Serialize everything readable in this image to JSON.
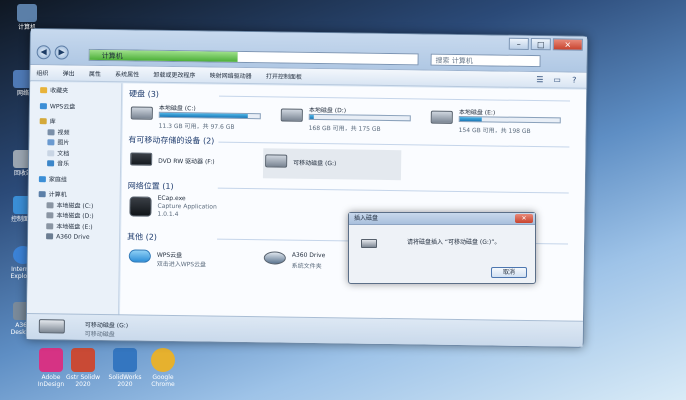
{
  "desktop": {
    "icons": [
      {
        "label": "计算机",
        "icon": "computer-icon",
        "color": "#5b7fa8"
      },
      {
        "label": "网络",
        "icon": "network-icon",
        "color": "#4e79b5"
      },
      {
        "label": "回收站",
        "icon": "recycle-bin-icon",
        "color": "#9aa5b1"
      },
      {
        "label": "控制面板",
        "icon": "control-panel-icon",
        "color": "#3a8ed6"
      },
      {
        "label": "Internet Explorer",
        "icon": "ie-icon",
        "color": "#3b82d6"
      },
      {
        "label": "A360 Desktop",
        "icon": "a360-icon",
        "color": "#7a8a9a"
      }
    ],
    "bottom_icons": [
      {
        "label": "Adobe InDesign",
        "icon": "indesign-icon",
        "color": "#d63384"
      },
      {
        "label": "Gstr Solidw 2020",
        "icon": "solidworks-icon",
        "color": "#c94a35"
      },
      {
        "label": "SolidWorks 2020",
        "icon": "solidworks2-icon",
        "color": "#3476c0"
      },
      {
        "label": "Google Chrome",
        "icon": "chrome-icon",
        "color": "#e6b12e"
      }
    ]
  },
  "window": {
    "address_text": "计算机",
    "search_placeholder": "搜索 计算机",
    "toolbar": [
      "组织",
      "弹出",
      "属性",
      "系统属性",
      "卸载或更改程序",
      "映射网络驱动器",
      "打开控制面板"
    ],
    "nav": [
      {
        "label": "收藏夹",
        "level": 1,
        "icon": "star-icon",
        "color": "#e8b33a"
      },
      {
        "label": "WPS云盘",
        "level": 1,
        "icon": "cloud-icon",
        "color": "#3b8ed6"
      },
      {
        "label": "库",
        "level": 1,
        "icon": "library-icon",
        "color": "#d4a93a"
      },
      {
        "label": "视频",
        "level": 2,
        "icon": "video-icon",
        "color": "#7a8fa8"
      },
      {
        "label": "图片",
        "level": 2,
        "icon": "picture-icon",
        "color": "#6a9ad0"
      },
      {
        "label": "文档",
        "level": 2,
        "icon": "document-icon",
        "color": "#c9d5e4"
      },
      {
        "label": "音乐",
        "level": 2,
        "icon": "music-icon",
        "color": "#3c86c9"
      },
      {
        "label": "家庭组",
        "level": 1,
        "icon": "homegroup-icon",
        "color": "#3b8ed6"
      },
      {
        "label": "计算机",
        "level": 1,
        "icon": "computer-icon",
        "color": "#5b7fa8"
      },
      {
        "label": "本地磁盘 (C:)",
        "level": 2,
        "icon": "drive-icon",
        "color": "#8a95a3"
      },
      {
        "label": "本地磁盘 (D:)",
        "level": 2,
        "icon": "drive-icon",
        "color": "#8a95a3"
      },
      {
        "label": "本地磁盘 (E:)",
        "level": 2,
        "icon": "drive-icon",
        "color": "#8a95a3"
      },
      {
        "label": "A360 Drive",
        "level": 2,
        "icon": "a360-icon",
        "color": "#6b7d92"
      }
    ],
    "sections": {
      "hard_disks": "硬盘 (3)",
      "removable": "有可移动存储的设备 (2)",
      "network": "网络位置 (1)",
      "other": "其他 (2)"
    },
    "drives": [
      {
        "name": "本地磁盘 (C:)",
        "free": "11.3 GB 可用，共 97.6 GB",
        "used_percent": 88
      },
      {
        "name": "本地磁盘 (D:)",
        "free": "168 GB 可用，共 175 GB",
        "used_percent": 4
      },
      {
        "name": "本地磁盘 (E:)",
        "free": "154 GB 可用，共 198 GB",
        "used_percent": 22
      }
    ],
    "removable": [
      {
        "name": "DVD RW 驱动器 (F:)",
        "icon": "dvd-drive-icon"
      },
      {
        "name": "可移动磁盘 (G:)",
        "icon": "removable-disk-icon"
      }
    ],
    "network_items": [
      {
        "name": "ECap.exe",
        "line2": "Capture Application",
        "line3": "1.0.1.4",
        "icon": "camera-icon"
      }
    ],
    "other_items": [
      {
        "name": "WPS云盘",
        "desc": "双击进入WPS云盘",
        "icon": "cloud-icon"
      },
      {
        "name": "A360 Drive",
        "desc": "系统文件夹",
        "icon": "a360-icon"
      }
    ],
    "status": {
      "name": "可移动磁盘 (G:)",
      "type": "可移动磁盘"
    }
  },
  "dialog": {
    "title": "插入磁盘",
    "message": "请将磁盘插入 “可移动磁盘 (G:)”。",
    "button": "取消"
  }
}
